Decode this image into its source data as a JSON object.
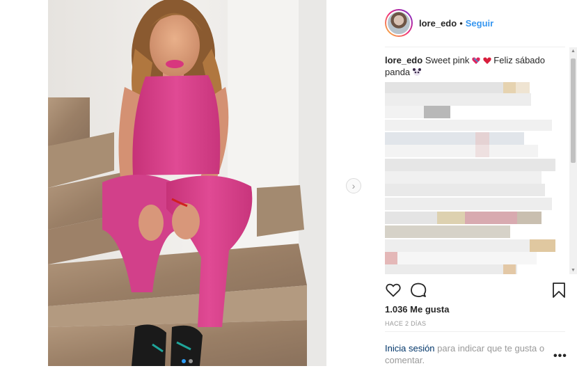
{
  "post": {
    "username": "lore_edo",
    "separator": "•",
    "follow_label": "Seguir",
    "caption_user": "lore_edo",
    "caption_text_1": "Sweet pink",
    "caption_text_2": "Feliz sábado",
    "caption_text_3": "panda",
    "likes": "1.036 Me gusta",
    "time_ago": "HACE 2 DÍAS",
    "login_link": "Inicia sesión",
    "login_text": "para indicar que te gusta o comentar.",
    "more_label": "•••",
    "next_arrow": "›"
  },
  "carousel": {
    "count": 2,
    "active": 1
  },
  "icons": {
    "like": "heart-icon",
    "comment": "comment-bubble-icon",
    "save": "bookmark-icon",
    "next": "chevron-right-icon"
  },
  "colors": {
    "follow": "#3897f0",
    "link": "#003569",
    "muted": "#999999",
    "text": "#262626",
    "jumpsuit": "#d83c8a"
  }
}
